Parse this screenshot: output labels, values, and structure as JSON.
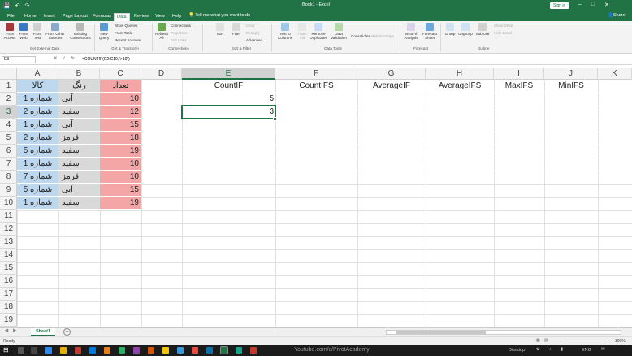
{
  "window": {
    "title": "Book1 - Excel",
    "signin": "Sign in",
    "share": "Share",
    "tell_me": "Tell me what you want to do"
  },
  "tabs": [
    "File",
    "Home",
    "Insert",
    "Page Layout",
    "Formulas",
    "Data",
    "Review",
    "View",
    "Help"
  ],
  "active_tab": "Data",
  "ribbon": {
    "buttons": [
      {
        "key": "from_access",
        "label": "From Access"
      },
      {
        "key": "from_web",
        "label": "From Web"
      },
      {
        "key": "from_text",
        "label": "From Text"
      },
      {
        "key": "from_other",
        "label": "From Other Sources"
      },
      {
        "key": "existing",
        "label": "Existing Connections"
      },
      {
        "key": "new_query",
        "label": "New Query"
      },
      {
        "key": "refresh",
        "label": "Refresh All"
      },
      {
        "key": "sort",
        "label": "Sort"
      },
      {
        "key": "filter",
        "label": "Filter"
      },
      {
        "key": "text_to_cols",
        "label": "Text to Columns"
      },
      {
        "key": "flash_fill",
        "label": "Flash Fill"
      },
      {
        "key": "remove_dup",
        "label": "Remove Duplicates"
      },
      {
        "key": "data_valid",
        "label": "Data Validation"
      },
      {
        "key": "consolidate",
        "label": "Consolidate"
      },
      {
        "key": "relationships",
        "label": "Relationships"
      },
      {
        "key": "what_if",
        "label": "What-If Analysis"
      },
      {
        "key": "forecast",
        "label": "Forecast Sheet"
      },
      {
        "key": "group",
        "label": "Group"
      },
      {
        "key": "ungroup",
        "label": "Ungroup"
      },
      {
        "key": "subtotal",
        "label": "Subtotal"
      }
    ],
    "small": {
      "show_queries": "Show Queries",
      "from_table": "From Table",
      "recent_sources": "Recent Sources",
      "connections": "Connections",
      "properties": "Properties",
      "edit_links": "Edit Links",
      "clear": "Clear",
      "reapply": "Reapply",
      "advanced": "Advanced",
      "show_detail": "Show Detail",
      "hide_detail": "Hide Detail"
    },
    "groups": {
      "get_external": "Get External Data",
      "get_transform": "Get & Transform",
      "connections": "Connections",
      "sort_filter": "Sort & Filter",
      "data_tools": "Data Tools",
      "forecast": "Forecast",
      "outline": "Outline"
    }
  },
  "formula_bar": {
    "name_box": "E3",
    "formula": "=COUNTIF(C2:C10,\">10\")",
    "cancel": "✕",
    "enter": "✓",
    "fx": "fx"
  },
  "columns": [
    "A",
    "B",
    "C",
    "D",
    "E",
    "F",
    "G",
    "H",
    "I",
    "J",
    "K"
  ],
  "selected_column": "E",
  "rows": [
    "1",
    "2",
    "3",
    "4",
    "5",
    "6",
    "7",
    "8",
    "9",
    "10",
    "11",
    "12",
    "13",
    "14",
    "15",
    "16",
    "17",
    "18",
    "19"
  ],
  "selected_row": "3",
  "table": {
    "headers": [
      "کالا",
      "رنگ",
      "تعداد"
    ],
    "rows": [
      [
        "شماره 1",
        "آبی",
        "10"
      ],
      [
        "شماره 2",
        "سفید",
        "12"
      ],
      [
        "شماره 1",
        "آبی",
        "15"
      ],
      [
        "شماره 2",
        "قرمز",
        "18"
      ],
      [
        "شماره 5",
        "سفید",
        "19"
      ],
      [
        "شماره 1",
        "سفید",
        "10"
      ],
      [
        "شماره 7",
        "قرمز",
        "10"
      ],
      [
        "شماره 5",
        "آبی",
        "15"
      ],
      [
        "شماره 1",
        "سفید",
        "19"
      ]
    ]
  },
  "function_headers": [
    "CountIF",
    "CountIFS",
    "AverageIF",
    "AverageIFS",
    "MaxIFS",
    "MinIFS"
  ],
  "results": {
    "E2": "5",
    "E3": "3"
  },
  "sheet_tab": "Sheet1",
  "add_sheet": "+",
  "status": {
    "ready": "Ready",
    "zoom": "100%"
  },
  "taskbar": {
    "watermark": "Youtube.com/c/PivotAcademy",
    "desktop": "Desktop",
    "lang": "ENG"
  },
  "colors": {
    "excel_green": "#217346",
    "col_a_fill": "#bdd7ee",
    "col_b_fill": "#d9d9d9",
    "col_c_fill": "#f4a5a5"
  }
}
